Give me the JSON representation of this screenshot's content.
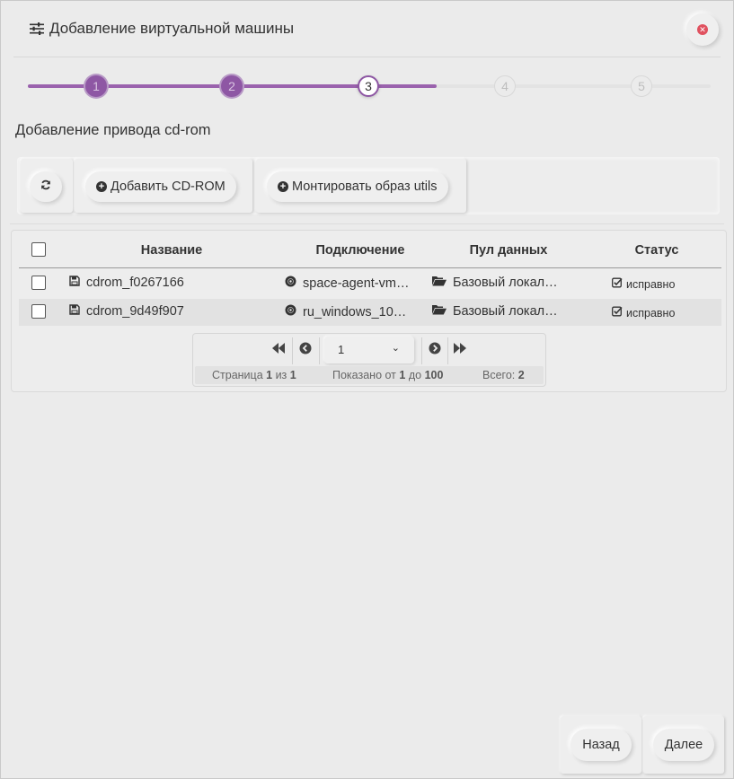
{
  "dialog": {
    "title": "Добавление виртуальной машины",
    "title_icon": "sliders-icon",
    "close_icon": "close-circle-icon"
  },
  "stepper": {
    "steps": [
      {
        "label": "1",
        "state": "done"
      },
      {
        "label": "2",
        "state": "done"
      },
      {
        "label": "3",
        "state": "current"
      },
      {
        "label": "4",
        "state": "future"
      },
      {
        "label": "5",
        "state": "future"
      }
    ],
    "accent_color": "#8e57a4"
  },
  "section": {
    "title": "Добавление привода cd-rom"
  },
  "toolbar": {
    "refresh_icon": "refresh-icon",
    "add_cdrom_label": "Добавить CD-ROM",
    "mount_utils_label": "Монтировать образ utils"
  },
  "table": {
    "columns": [
      "Название",
      "Подключение",
      "Пул данных",
      "Статус"
    ],
    "rows": [
      {
        "name": "cdrom_f0267166",
        "connection": "space-agent-vm…",
        "pool": "Базовый локал…",
        "status": "исправно"
      },
      {
        "name": "cdrom_9d49f907",
        "connection": "ru_windows_10…",
        "pool": "Базовый локал…",
        "status": "исправно"
      }
    ]
  },
  "pager": {
    "selected_page": "1",
    "page_label": "Страница",
    "page_current": "1",
    "of_label": "из",
    "page_total": "1",
    "shown_label": "Показано от",
    "shown_from": "1",
    "to_label": "до",
    "shown_to": "100",
    "total_label": "Всего:",
    "total": "2"
  },
  "footer": {
    "back_label": "Назад",
    "next_label": "Далее"
  }
}
